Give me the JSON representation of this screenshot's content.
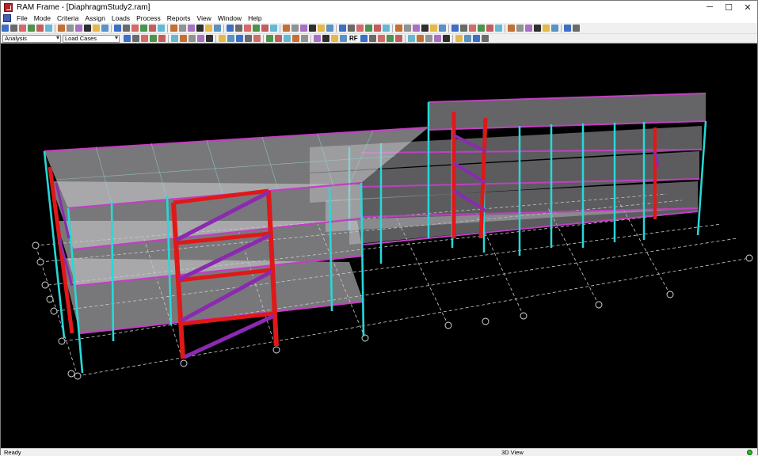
{
  "window": {
    "title": "RAM Frame - [DiaphragmStudy2.ram]",
    "controls": {
      "minimize": "─",
      "maximize": "☐",
      "close": "✕"
    },
    "mdi_controls": {
      "minimize": "–",
      "restore": "❐",
      "close": "×"
    }
  },
  "menu": {
    "items": [
      "File",
      "Mode",
      "Criteria",
      "Assign",
      "Loads",
      "Process",
      "Reports",
      "View",
      "Window",
      "Help"
    ]
  },
  "toolbar": {
    "mode_combo": "Analysis",
    "loadcase_combo": "Load Cases",
    "text_buttons": {
      "rf": "RF"
    },
    "icon_colors": [
      "#1a1a1a",
      "#c83030",
      "#6a6a6a",
      "#2a5fc0",
      "#2aa0c8",
      "#e0a000",
      "#3a8a3a",
      "#8a3ab0",
      "#303030",
      "#c06020",
      "#1a6ab0",
      "#b02020"
    ]
  },
  "status": {
    "left": "Ready",
    "middle": "3D View",
    "indicator_color": "#22c022"
  },
  "view": {
    "background": "#000000",
    "colors": {
      "column": "#28d8d8",
      "brace": "#8a2ab0",
      "frame": "#e01818",
      "beam": "#c040c0",
      "slab": "#c8c8cc",
      "grid": "#d0d0d0"
    }
  }
}
